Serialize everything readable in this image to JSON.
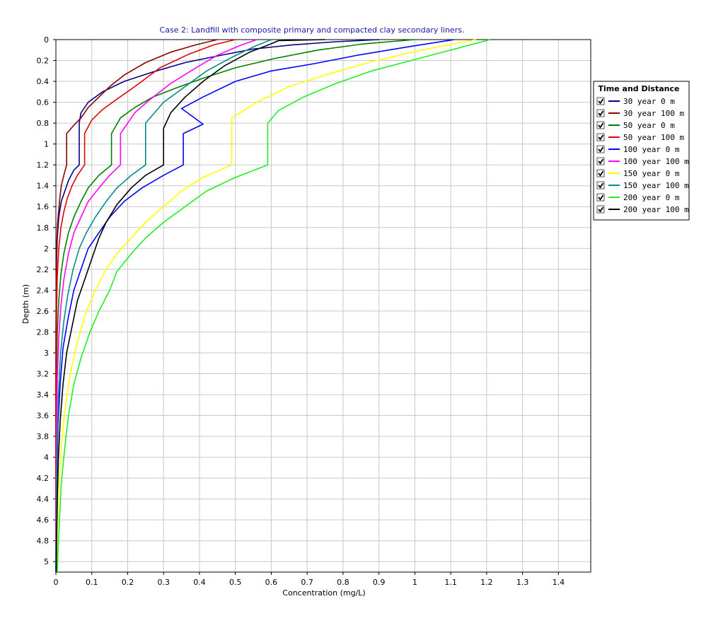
{
  "chart_data": {
    "type": "line",
    "title": "Case 2: Landfill with composite primary and compacted clay secondary liners.",
    "xlabel": "Concentration (mg/L)",
    "ylabel": "Depth (m)",
    "xlim": [
      0,
      1.49
    ],
    "ylim": [
      0,
      5.1
    ],
    "y_inverted": true,
    "x_ticks": [
      "0",
      "0.1",
      "0.2",
      "0.3",
      "0.4",
      "0.5",
      "0.6",
      "0.7",
      "0.8",
      "0.9",
      "1",
      "1.1",
      "1.2",
      "1.3",
      "1.4"
    ],
    "y_ticks": [
      "0",
      "0.2",
      "0.4",
      "0.6",
      "0.8",
      "1",
      "1.2",
      "1.4",
      "1.6",
      "1.8",
      "2",
      "2.2",
      "2.4",
      "2.6",
      "2.8",
      "3",
      "3.2",
      "3.4",
      "3.6",
      "3.8",
      "4",
      "4.2",
      "4.4",
      "4.6",
      "4.8",
      "5"
    ],
    "grid": true,
    "legend": {
      "title": "Time and Distance",
      "position": "right"
    },
    "series": [
      {
        "name": "30 year  0 m",
        "color": "#00008b",
        "checked": true,
        "points": [
          [
            0.9,
            0
          ],
          [
            0.78,
            0.02
          ],
          [
            0.66,
            0.05
          ],
          [
            0.55,
            0.09
          ],
          [
            0.46,
            0.15
          ],
          [
            0.36,
            0.22
          ],
          [
            0.27,
            0.31
          ],
          [
            0.19,
            0.4
          ],
          [
            0.13,
            0.5
          ],
          [
            0.09,
            0.6
          ],
          [
            0.07,
            0.7
          ],
          [
            0.065,
            0.8
          ],
          [
            0.065,
            0.9
          ],
          [
            0.065,
            1.2
          ],
          [
            0.05,
            1.25
          ],
          [
            0.035,
            1.35
          ],
          [
            0.025,
            1.45
          ],
          [
            0.015,
            1.55
          ],
          [
            0.008,
            1.7
          ],
          [
            0.004,
            1.9
          ],
          [
            0.002,
            2.1
          ],
          [
            0.001,
            2.4
          ],
          [
            0.0005,
            2.8
          ],
          [
            0,
            3.2
          ],
          [
            0,
            5.1
          ]
        ]
      },
      {
        "name": "30 year  100 m",
        "color": "#8b0000",
        "checked": true,
        "points": [
          [
            0.45,
            0
          ],
          [
            0.39,
            0.05
          ],
          [
            0.32,
            0.12
          ],
          [
            0.25,
            0.22
          ],
          [
            0.19,
            0.34
          ],
          [
            0.15,
            0.45
          ],
          [
            0.12,
            0.55
          ],
          [
            0.09,
            0.65
          ],
          [
            0.07,
            0.75
          ],
          [
            0.05,
            0.82
          ],
          [
            0.03,
            0.9
          ],
          [
            0.03,
            1.2
          ],
          [
            0.022,
            1.3
          ],
          [
            0.015,
            1.4
          ],
          [
            0.01,
            1.55
          ],
          [
            0.005,
            1.75
          ],
          [
            0.002,
            2.0
          ],
          [
            0.001,
            2.4
          ],
          [
            0,
            2.8
          ],
          [
            0,
            5.1
          ]
        ]
      },
      {
        "name": "50 year  0 m",
        "color": "#008000",
        "checked": true,
        "points": [
          [
            1.0,
            0
          ],
          [
            0.86,
            0.04
          ],
          [
            0.73,
            0.1
          ],
          [
            0.61,
            0.18
          ],
          [
            0.5,
            0.27
          ],
          [
            0.41,
            0.37
          ],
          [
            0.33,
            0.47
          ],
          [
            0.27,
            0.55
          ],
          [
            0.22,
            0.65
          ],
          [
            0.18,
            0.75
          ],
          [
            0.155,
            0.9
          ],
          [
            0.155,
            1.2
          ],
          [
            0.12,
            1.3
          ],
          [
            0.09,
            1.42
          ],
          [
            0.07,
            1.55
          ],
          [
            0.05,
            1.7
          ],
          [
            0.035,
            1.85
          ],
          [
            0.022,
            2.05
          ],
          [
            0.014,
            2.25
          ],
          [
            0.008,
            2.5
          ],
          [
            0.004,
            2.8
          ],
          [
            0.002,
            3.2
          ],
          [
            0.001,
            3.6
          ],
          [
            0,
            4.0
          ],
          [
            0,
            5.1
          ]
        ]
      },
      {
        "name": "50 year  100 m",
        "color": "#e00000",
        "checked": true,
        "points": [
          [
            0.5,
            0
          ],
          [
            0.44,
            0.05
          ],
          [
            0.37,
            0.14
          ],
          [
            0.29,
            0.27
          ],
          [
            0.22,
            0.45
          ],
          [
            0.17,
            0.57
          ],
          [
            0.13,
            0.67
          ],
          [
            0.1,
            0.77
          ],
          [
            0.08,
            0.9
          ],
          [
            0.08,
            1.2
          ],
          [
            0.06,
            1.3
          ],
          [
            0.045,
            1.4
          ],
          [
            0.032,
            1.52
          ],
          [
            0.022,
            1.65
          ],
          [
            0.014,
            1.8
          ],
          [
            0.008,
            2.0
          ],
          [
            0.004,
            2.25
          ],
          [
            0.002,
            2.6
          ],
          [
            0.001,
            3.0
          ],
          [
            0,
            3.4
          ],
          [
            0,
            5.1
          ]
        ]
      },
      {
        "name": "100 year  0 m",
        "color": "#0000ff",
        "checked": true,
        "points": [
          [
            1.11,
            0
          ],
          [
            0.98,
            0.07
          ],
          [
            0.84,
            0.15
          ],
          [
            0.72,
            0.23
          ],
          [
            0.6,
            0.3
          ],
          [
            0.5,
            0.4
          ],
          [
            0.41,
            0.55
          ],
          [
            0.35,
            0.66
          ],
          [
            0.41,
            0.81
          ],
          [
            0.355,
            0.9
          ],
          [
            0.355,
            1.2
          ],
          [
            0.3,
            1.3
          ],
          [
            0.24,
            1.42
          ],
          [
            0.19,
            1.55
          ],
          [
            0.15,
            1.7
          ],
          [
            0.12,
            1.85
          ],
          [
            0.09,
            2.0
          ],
          [
            0.07,
            2.2
          ],
          [
            0.05,
            2.4
          ],
          [
            0.035,
            2.65
          ],
          [
            0.02,
            2.95
          ],
          [
            0.012,
            3.3
          ],
          [
            0.006,
            3.7
          ],
          [
            0.003,
            4.2
          ],
          [
            0.001,
            4.8
          ],
          [
            0,
            5.1
          ]
        ]
      },
      {
        "name": "100 year  100 m",
        "color": "#ff00ff",
        "checked": true,
        "points": [
          [
            0.56,
            0
          ],
          [
            0.51,
            0.06
          ],
          [
            0.45,
            0.15
          ],
          [
            0.39,
            0.27
          ],
          [
            0.32,
            0.42
          ],
          [
            0.26,
            0.58
          ],
          [
            0.22,
            0.7
          ],
          [
            0.18,
            0.9
          ],
          [
            0.18,
            1.2
          ],
          [
            0.15,
            1.3
          ],
          [
            0.12,
            1.42
          ],
          [
            0.09,
            1.55
          ],
          [
            0.07,
            1.7
          ],
          [
            0.05,
            1.85
          ],
          [
            0.035,
            2.05
          ],
          [
            0.022,
            2.3
          ],
          [
            0.014,
            2.55
          ],
          [
            0.008,
            2.85
          ],
          [
            0.004,
            3.25
          ],
          [
            0.002,
            3.7
          ],
          [
            0.001,
            4.2
          ],
          [
            0,
            4.6
          ],
          [
            0,
            5.1
          ]
        ]
      },
      {
        "name": "150 year  0 m",
        "color": "#ffff00",
        "checked": true,
        "points": [
          [
            1.17,
            0
          ],
          [
            1.02,
            0.1
          ],
          [
            0.87,
            0.22
          ],
          [
            0.75,
            0.34
          ],
          [
            0.65,
            0.45
          ],
          [
            0.56,
            0.6
          ],
          [
            0.49,
            0.75
          ],
          [
            0.49,
            0.9
          ],
          [
            0.49,
            1.2
          ],
          [
            0.41,
            1.32
          ],
          [
            0.35,
            1.45
          ],
          [
            0.3,
            1.6
          ],
          [
            0.25,
            1.75
          ],
          [
            0.21,
            1.9
          ],
          [
            0.17,
            2.05
          ],
          [
            0.14,
            2.2
          ],
          [
            0.11,
            2.4
          ],
          [
            0.08,
            2.65
          ],
          [
            0.06,
            2.9
          ],
          [
            0.04,
            3.2
          ],
          [
            0.025,
            3.55
          ],
          [
            0.015,
            3.9
          ],
          [
            0.008,
            4.3
          ],
          [
            0.004,
            4.7
          ],
          [
            0.002,
            5.1
          ]
        ]
      },
      {
        "name": "150 year  100 m",
        "color": "#008b8b",
        "checked": true,
        "points": [
          [
            0.6,
            0
          ],
          [
            0.55,
            0.07
          ],
          [
            0.49,
            0.17
          ],
          [
            0.42,
            0.3
          ],
          [
            0.36,
            0.45
          ],
          [
            0.3,
            0.6
          ],
          [
            0.25,
            0.8
          ],
          [
            0.25,
            0.9
          ],
          [
            0.25,
            1.2
          ],
          [
            0.21,
            1.3
          ],
          [
            0.17,
            1.42
          ],
          [
            0.14,
            1.55
          ],
          [
            0.11,
            1.7
          ],
          [
            0.085,
            1.85
          ],
          [
            0.065,
            2.0
          ],
          [
            0.048,
            2.2
          ],
          [
            0.033,
            2.45
          ],
          [
            0.022,
            2.7
          ],
          [
            0.013,
            3.0
          ],
          [
            0.007,
            3.4
          ],
          [
            0.004,
            3.85
          ],
          [
            0.002,
            4.3
          ],
          [
            0.001,
            4.8
          ],
          [
            0,
            5.1
          ]
        ]
      },
      {
        "name": "200 year  0 m",
        "color": "#22ee22",
        "checked": true,
        "points": [
          [
            1.21,
            0
          ],
          [
            1.1,
            0.1
          ],
          [
            0.99,
            0.2
          ],
          [
            0.88,
            0.3
          ],
          [
            0.78,
            0.42
          ],
          [
            0.69,
            0.55
          ],
          [
            0.62,
            0.68
          ],
          [
            0.59,
            0.8
          ],
          [
            0.59,
            0.9
          ],
          [
            0.59,
            1.2
          ],
          [
            0.5,
            1.32
          ],
          [
            0.42,
            1.45
          ],
          [
            0.36,
            1.6
          ],
          [
            0.3,
            1.75
          ],
          [
            0.25,
            1.9
          ],
          [
            0.21,
            2.05
          ],
          [
            0.17,
            2.22
          ],
          [
            0.15,
            2.4
          ],
          [
            0.12,
            2.6
          ],
          [
            0.095,
            2.8
          ],
          [
            0.07,
            3.05
          ],
          [
            0.05,
            3.3
          ],
          [
            0.035,
            3.6
          ],
          [
            0.025,
            3.9
          ],
          [
            0.015,
            4.25
          ],
          [
            0.01,
            4.6
          ],
          [
            0.006,
            4.9
          ],
          [
            0.004,
            5.1
          ]
        ]
      },
      {
        "name": "200 year  100 m",
        "color": "#000000",
        "checked": true,
        "points": [
          [
            0.75,
            0
          ],
          [
            0.62,
            0.01
          ],
          [
            0.6,
            0.04
          ],
          [
            0.54,
            0.12
          ],
          [
            0.47,
            0.25
          ],
          [
            0.41,
            0.4
          ],
          [
            0.36,
            0.55
          ],
          [
            0.32,
            0.7
          ],
          [
            0.3,
            0.85
          ],
          [
            0.3,
            0.9
          ],
          [
            0.3,
            1.2
          ],
          [
            0.25,
            1.3
          ],
          [
            0.21,
            1.42
          ],
          [
            0.17,
            1.58
          ],
          [
            0.14,
            1.75
          ],
          [
            0.12,
            1.9
          ],
          [
            0.1,
            2.1
          ],
          [
            0.08,
            2.3
          ],
          [
            0.06,
            2.5
          ],
          [
            0.045,
            2.75
          ],
          [
            0.03,
            3.0
          ],
          [
            0.02,
            3.3
          ],
          [
            0.012,
            3.65
          ],
          [
            0.007,
            4.0
          ],
          [
            0.004,
            4.4
          ],
          [
            0.002,
            4.8
          ],
          [
            0.001,
            5.1
          ]
        ]
      }
    ]
  }
}
